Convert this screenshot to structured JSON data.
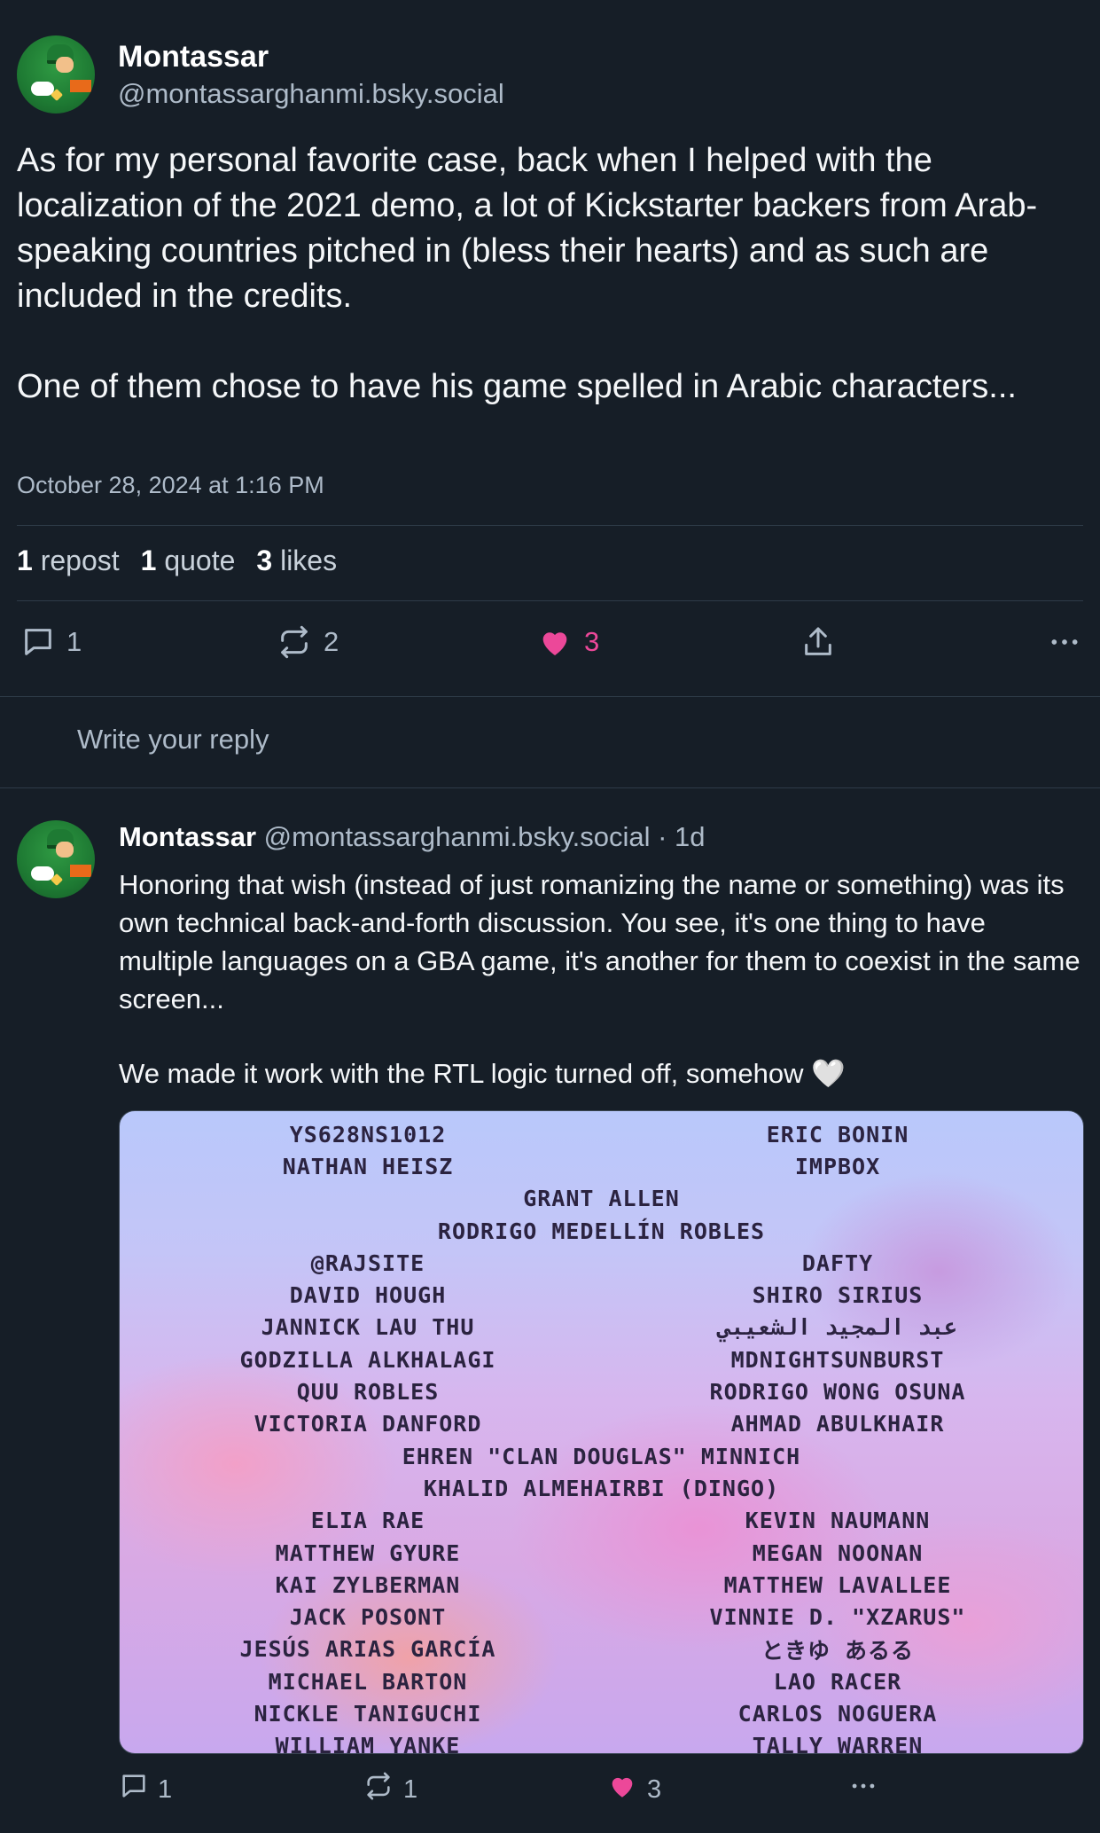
{
  "post": {
    "author_name": "Montassar",
    "author_handle": "@montassarghanmi.bsky.social",
    "paragraph_1": "As for my personal favorite case, back when I helped with the localization of the 2021 demo, a lot of Kickstarter backers from Arab-speaking countries pitched in (bless their hearts) and as such are included in the credits.",
    "paragraph_2": "One of them chose to have his game spelled in Arabic characters...",
    "timestamp": "October 28, 2024 at 1:16 PM",
    "stats": {
      "reposts_count": "1",
      "reposts_label": "repost",
      "quotes_count": "1",
      "quotes_label": "quote",
      "likes_count": "3",
      "likes_label": "likes"
    },
    "actions": {
      "reply_count": "1",
      "repost_count": "2",
      "like_count": "3"
    }
  },
  "reply_box": {
    "placeholder": "Write your reply"
  },
  "reply": {
    "author_name": "Montassar",
    "author_handle": "@montassarghanmi.bsky.social",
    "separator": "·",
    "age": "1d",
    "paragraph_1": "Honoring that wish (instead of just romanizing the name or something) was its own technical back-and-forth discussion. You see, it's one thing to have multiple languages on a GBA game, it's another for them to coexist in the same screen...",
    "paragraph_2": "We made it work with the RTL logic turned off, somehow 🤍",
    "actions": {
      "reply_count": "1",
      "repost_count": "1",
      "like_count": "3"
    },
    "image_credits": [
      {
        "left": "YS628NS1012",
        "right": "ERIC BONIN"
      },
      {
        "left": "NATHAN HEISZ",
        "right": "IMPBOX"
      },
      {
        "center": "GRANT ALLEN"
      },
      {
        "center": "RODRIGO MEDELLÍN ROBLES"
      },
      {
        "left": "@RAJSITE",
        "right": "DAFTY"
      },
      {
        "left": "DAVID HOUGH",
        "right": "SHIRO SIRIUS"
      },
      {
        "left": "JANNICK LAU THU",
        "right": "عبد المجيد الشعيبي"
      },
      {
        "left": "GODZILLA ALKHALAGI",
        "right": "MDNIGHTSUNBURST"
      },
      {
        "left": "QUU ROBLES",
        "right": "RODRIGO WONG OSUNA"
      },
      {
        "left": "VICTORIA DANFORD",
        "right": "AHMAD ABULKHAIR"
      },
      {
        "center": "EHREN \"CLAN DOUGLAS\" MINNICH"
      },
      {
        "center": "KHALID ALMEHAIRBI (DINGO)"
      },
      {
        "left": "ELIA RAE",
        "right": "KEVIN NAUMANN"
      },
      {
        "left": "MATTHEW GYURE",
        "right": "MEGAN NOONAN"
      },
      {
        "left": "KAI ZYLBERMAN",
        "right": "MATTHEW LAVALLEE"
      },
      {
        "left": "JACK POSONT",
        "right": "VINNIE D. \"XZARUS\""
      },
      {
        "left": "JESÚS ARIAS GARCÍA",
        "right": "ときゆ あるる"
      },
      {
        "left": "MICHAEL BARTON",
        "right": "LAO RACER"
      },
      {
        "left": "NICKLE TANIGUCHI",
        "right": "CARLOS NOGUERA"
      },
      {
        "left": "WILLIAM YANKE",
        "right": "TALLY WARREN"
      }
    ]
  },
  "colors": {
    "background": "#161e27",
    "text": "#f1f3f5",
    "muted": "#aebbc9",
    "like": "#ec4899",
    "divider": "#2e3b48"
  }
}
